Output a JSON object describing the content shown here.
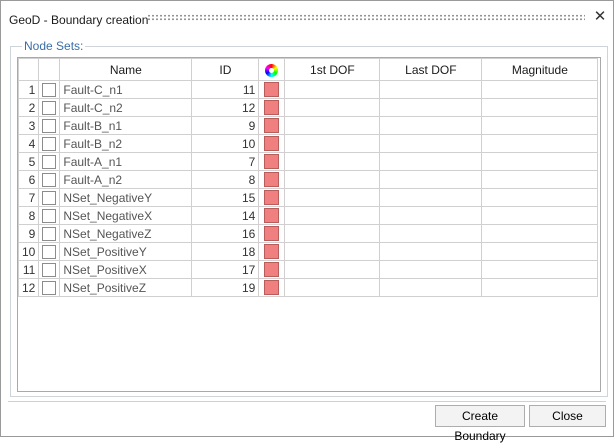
{
  "window": {
    "title": "GeoD - Boundary creation",
    "close_glyph": "✕"
  },
  "group": {
    "label": "Node Sets:"
  },
  "table": {
    "columns": {
      "name": "Name",
      "id": "ID",
      "color_icon": "color-wheel-icon",
      "first_dof": "1st DOF",
      "last_dof": "Last DOF",
      "magnitude": "Magnitude"
    },
    "rows": [
      {
        "num": "1",
        "name": "Fault-C_n1",
        "id": "11"
      },
      {
        "num": "2",
        "name": "Fault-C_n2",
        "id": "12"
      },
      {
        "num": "3",
        "name": "Fault-B_n1",
        "id": "9"
      },
      {
        "num": "4",
        "name": "Fault-B_n2",
        "id": "10"
      },
      {
        "num": "5",
        "name": "Fault-A_n1",
        "id": "7"
      },
      {
        "num": "6",
        "name": "Fault-A_n2",
        "id": "8"
      },
      {
        "num": "7",
        "name": "NSet_NegativeY",
        "id": "15"
      },
      {
        "num": "8",
        "name": "NSet_NegativeX",
        "id": "14"
      },
      {
        "num": "9",
        "name": "NSet_NegativeZ",
        "id": "16"
      },
      {
        "num": "10",
        "name": "NSet_PositiveY",
        "id": "18"
      },
      {
        "num": "11",
        "name": "NSet_PositiveX",
        "id": "17"
      },
      {
        "num": "12",
        "name": "NSet_PositiveZ",
        "id": "19"
      }
    ],
    "swatch_color": "#f08080"
  },
  "buttons": {
    "create": "Create Boundary",
    "close": "Close"
  }
}
